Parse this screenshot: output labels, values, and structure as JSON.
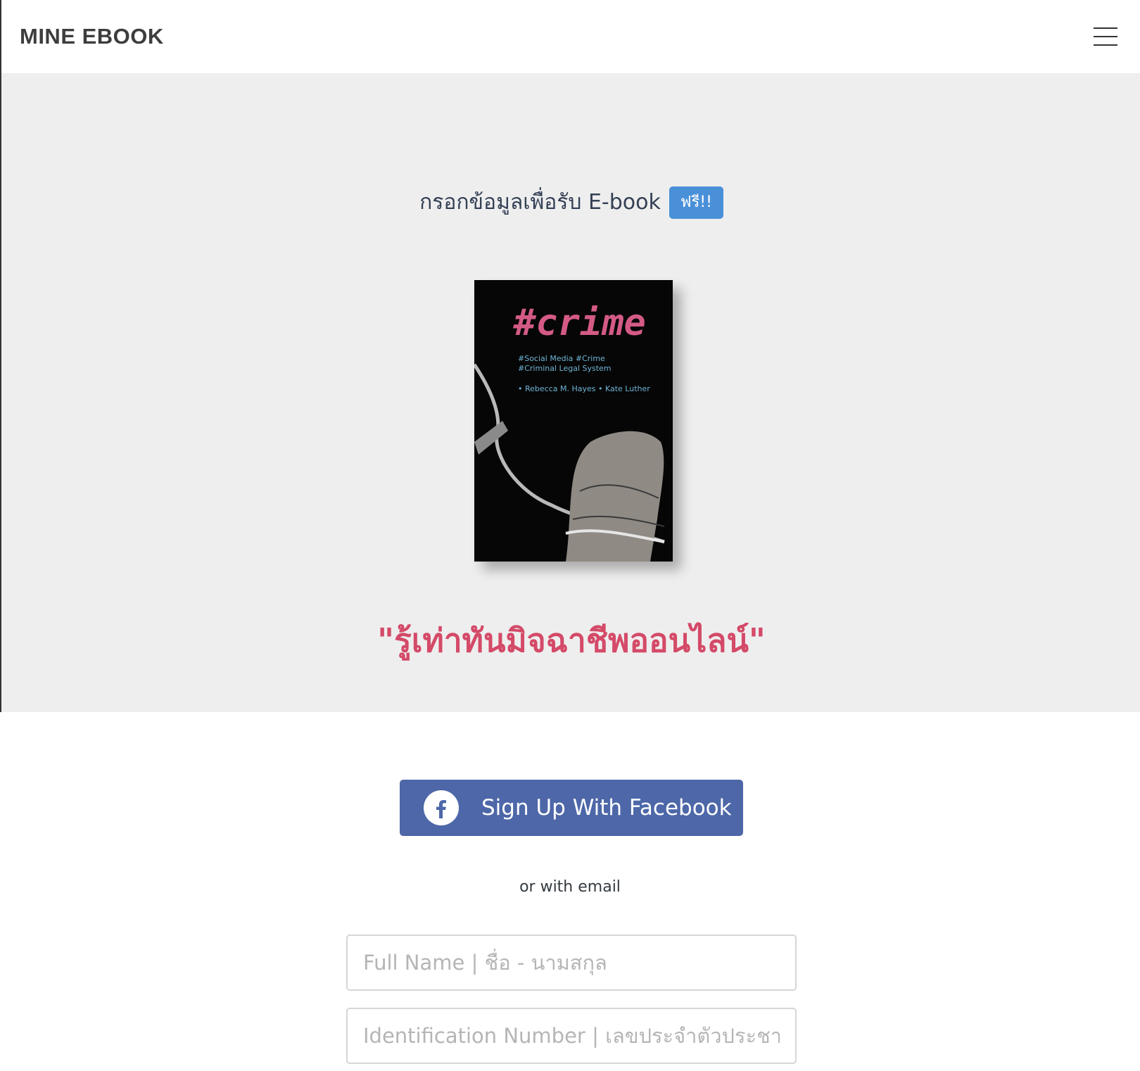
{
  "header": {
    "brand": "MINE EBOOK",
    "menu_icon": "hamburger-menu-icon"
  },
  "hero": {
    "heading": "กรอกข้อมูลเพื่อรับ E-book",
    "badge": "ฟรี!!",
    "badge_color": "#4a90d9",
    "background": "#eeeeee",
    "cover": {
      "title": "#crime",
      "subtitle_line1": "#Social Media #Crime",
      "subtitle_line2": "#Criminal Legal System",
      "authors": "• Rebecca M. Hayes • Kate Luther"
    },
    "tagline": "\"รู้เท่าทันมิจฉาชีพออนไลน์\"",
    "tagline_color": "#d44a68"
  },
  "signup": {
    "facebook_label": "Sign Up With Facebook",
    "facebook_icon": "facebook-icon",
    "facebook_color": "#4d67a8",
    "divider_text": "or with email",
    "fields": {
      "full_name_placeholder": "Full Name | ชื่อ - นามสกุล",
      "id_placeholder": "Identification Number | เลขประจำตัวประชา"
    }
  }
}
